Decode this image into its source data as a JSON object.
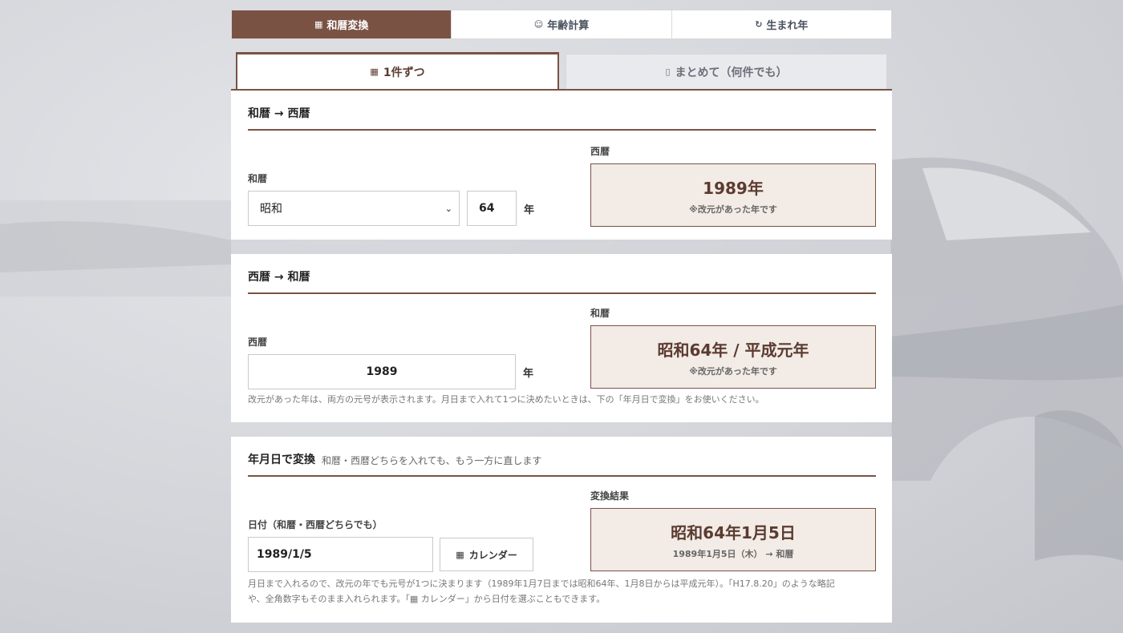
{
  "top_tabs": [
    {
      "icon": "calendar-icon",
      "label": "和暦変換"
    },
    {
      "icon": "face-icon",
      "label": "年齢計算"
    },
    {
      "icon": "cycle-icon",
      "label": "生まれ年"
    }
  ],
  "sub_tabs": [
    {
      "icon": "calendar-icon",
      "label": "1件ずつ"
    },
    {
      "icon": "clipboard-icon",
      "label": "まとめて（何件でも）"
    }
  ],
  "wareki_to_seireki": {
    "title": "和暦 → 西暦",
    "input_label": "和暦",
    "era_value": "昭和",
    "year_value": "64",
    "unit": "年",
    "result_label": "西暦",
    "result_main": "1989年",
    "result_note": "※改元があった年です"
  },
  "seireki_to_wareki": {
    "title": "西暦 → 和暦",
    "input_label": "西暦",
    "year_value": "1989",
    "unit": "年",
    "result_label": "和暦",
    "result_main": "昭和64年 / 平成元年",
    "result_note": "※改元があった年です",
    "help": "改元があった年は、両方の元号が表示されます。月日まで入れて1つに決めたいときは、下の「年月日で変換」をお使いください。"
  },
  "date_convert": {
    "title": "年月日で変換",
    "subtitle": "和暦・西暦どちらを入れても、もう一方に直します",
    "input_label": "日付（和暦・西暦どちらでも）",
    "date_value": "1989/1/5",
    "calendar_button": "カレンダー",
    "result_label": "変換結果",
    "result_main": "昭和64年1月5日",
    "result_note": "1989年1月5日（木） → 和暦",
    "help_line1": "月日まで入れるので、改元の年でも元号が1つに決まります（1989年1月7日までは昭和64年、1月8日からは平成元年）。「H17.8.20」のような略記",
    "help_line2": "や、全角数字もそのまま入れられます。「▦ カレンダー」から日付を選ぶこともできます。"
  },
  "colors": {
    "accent": "#7a5244",
    "result_bg": "#f2ebe6",
    "result_text": "#5b3b30"
  }
}
